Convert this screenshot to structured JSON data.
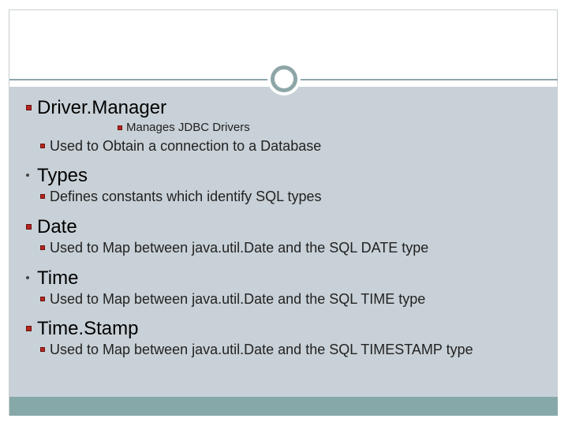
{
  "colors": {
    "accent_square": "#b8241e",
    "panel": "#c8d1d7",
    "footer": "#87a8a9",
    "ring": "#8ea6a8"
  },
  "bullets": [
    {
      "text": "Driver.Manager",
      "marker": "red-square"
    },
    {
      "text": "Manages JDBC Drivers",
      "marker": "red-square"
    },
    {
      "text": "Used to Obtain a connection to a Database",
      "marker": "red-square"
    },
    {
      "text": "Types",
      "marker": "dot"
    },
    {
      "text": "Defines constants which identify SQL types",
      "marker": "red-square"
    },
    {
      "text": "Date",
      "marker": "red-square"
    },
    {
      "text": "Used to Map between java.util.Date and the SQL DATE type",
      "marker": "red-square"
    },
    {
      "text": "Time",
      "marker": "dot"
    },
    {
      "text": "Used to Map between java.util.Date and the SQL TIME type",
      "marker": "red-square"
    },
    {
      "text": "Time.Stamp",
      "marker": "red-square"
    },
    {
      "text": "Used to Map between java.util.Date and the SQL TIMESTAMP type",
      "marker": "red-square"
    }
  ]
}
